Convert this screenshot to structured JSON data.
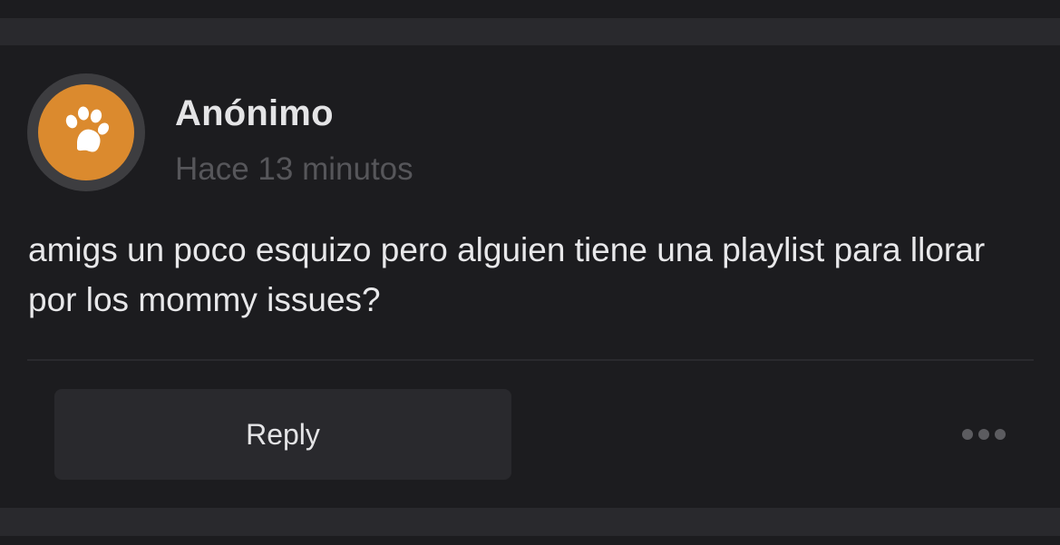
{
  "post": {
    "author": "Anónimo",
    "timestamp": "Hace 13 minutos",
    "body": "amigs un poco esquizo pero alguien tiene una playlist para llorar por los mommy issues?"
  },
  "actions": {
    "reply_label": "Reply",
    "more_icon": "more-horizontal-icon"
  },
  "avatar": {
    "icon": "paw-icon",
    "background_color": "#db8a2e",
    "ring_color": "#3d3d40"
  },
  "colors": {
    "background": "#1c1c1f",
    "band": "#29292d",
    "text_primary": "#e4e4e6",
    "text_secondary": "#56565a"
  }
}
